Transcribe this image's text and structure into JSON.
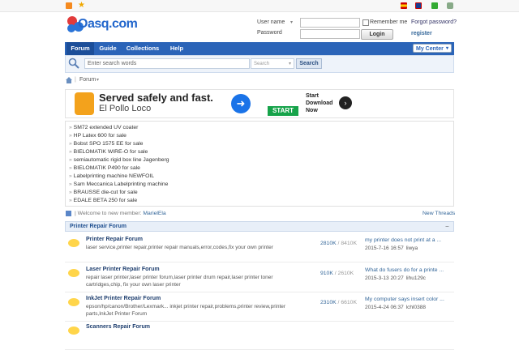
{
  "login": {
    "username_label": "User name",
    "password_label": "Password",
    "remember_label": "Remember me",
    "forgot_link": "Forgot password?",
    "login_button": "Login",
    "register_link": "register"
  },
  "logo": {
    "text": "Oasq.com"
  },
  "nav": {
    "items": [
      {
        "label": "Forum"
      },
      {
        "label": "Guide"
      },
      {
        "label": "Collections"
      },
      {
        "label": "Help"
      }
    ],
    "my_center": "My Center"
  },
  "search": {
    "placeholder": "Enter search words",
    "scope": "Search",
    "button": "Search"
  },
  "breadcrumb": {
    "current": "Forum"
  },
  "ad": {
    "headline": "Served safely and fast.",
    "brand": "El Pollo Loco",
    "cta_text": "Start Download Now",
    "cta_button": "START"
  },
  "news": [
    "SM72 extended UV coater",
    "HP Latex 600 for sale",
    "Bobst SPO 1575 EE for sale",
    "BIELOMATIK WIRE-O for sale",
    "semiautomatic rigid box line Jagenberg",
    "BIELOMATIK P490 for sale",
    "Labelprinting machine NEWFOIL",
    "Sam Meccanica Labelprinting machine",
    "BRAUSSE die-cut for sale",
    "EDALE BETA 250 for sale"
  ],
  "welcome": {
    "text": "Welcome to new member:",
    "member": "MarielEla",
    "new_threads": "New Threads"
  },
  "section": {
    "title": "Printer Repair Forum",
    "toggle": "−"
  },
  "forums": [
    {
      "title": "Printer Repair Forum",
      "desc": "laser service,printer repair,printer repair manuals,error,codes,fix your own printer",
      "threads": "2810K",
      "posts": "8410K",
      "last_title": "my printer does not print at a ...",
      "last_date": "2015-7-16 16:57",
      "last_user": "liwya"
    },
    {
      "title": "Laser Printer Repair Forum",
      "desc": "repair laser printer,laser printer forum,laser printer drum repair,laser printer toner cartridges,chip, fix your own laser printer",
      "threads": "910K",
      "posts": "2610K",
      "last_title": "What do fusers do for a printe ...",
      "last_date": "2015-3-13 20:27",
      "last_user": "lihu129c"
    },
    {
      "title": "InkJet Printer Repair Forum",
      "desc": "epson/hp/canon/Brother/Lexmark... inkjet printer repair,problems,printer review,printer parts,InkJet Printer Forum",
      "threads": "2310K",
      "posts": "6610K",
      "last_title": "My computer says insert color ...",
      "last_date": "2015-4-24 06:37",
      "last_user": "lchl0388"
    },
    {
      "title": "Scanners Repair Forum"
    }
  ],
  "colors": {
    "nav": "#2b64b8",
    "link": "#336699",
    "accent_yellow": "#ffd54a"
  }
}
